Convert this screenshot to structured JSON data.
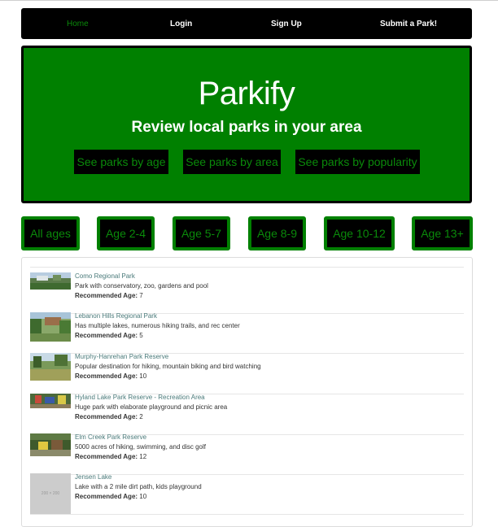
{
  "nav": {
    "home": "Home",
    "login": "Login",
    "signup": "Sign Up",
    "submit": "Submit a Park!"
  },
  "hero": {
    "title": "Parkify",
    "subtitle": "Review local parks in your area",
    "btn_age": "See parks by age",
    "btn_area": "See parks by area",
    "btn_popularity": "See parks by popularity"
  },
  "age_filters": [
    "All ages",
    "Age 2-4",
    "Age 5-7",
    "Age 8-9",
    "Age 10-12",
    "Age 13+"
  ],
  "recommended_label": "Recommended Age:",
  "parks": [
    {
      "name": "Como Regional Park",
      "desc": "Park with conservatory, zoo, gardens and pool",
      "age": "7"
    },
    {
      "name": "Lebanon Hills Regional Park",
      "desc": "Has multiple lakes, numerous hiking trails, and rec center",
      "age": "5"
    },
    {
      "name": "Murphy-Hanrehan Park Reserve",
      "desc": "Popular destination for hiking, mountain biking and bird watching",
      "age": "10"
    },
    {
      "name": "Hyland Lake Park Reserve - Recreation Area",
      "desc": "Huge park with elaborate playground and picnic area",
      "age": "2"
    },
    {
      "name": "Elm Creek Park Reserve",
      "desc": "5000 acres of hiking, swimming, and disc golf",
      "age": "12"
    },
    {
      "name": "Jensen Lake",
      "desc": "Lake with a 2 mile dirt path, kids playground",
      "age": "10"
    }
  ],
  "placeholder_text": "200 × 200",
  "colors": {
    "brand_green": "#008000",
    "nav_bg": "#000000",
    "link": "#4a7a7a"
  }
}
